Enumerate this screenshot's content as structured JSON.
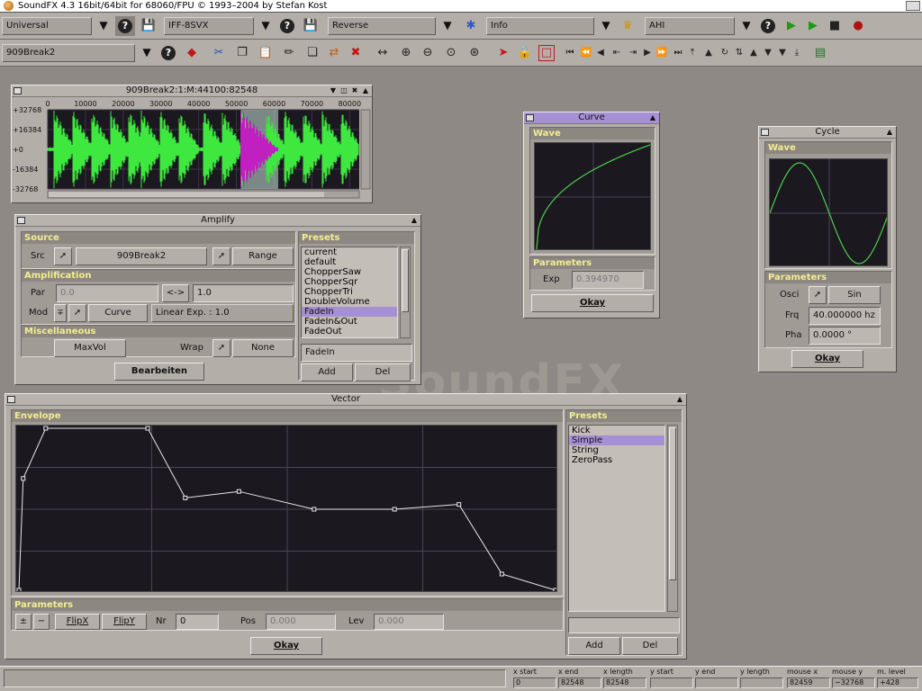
{
  "app": {
    "title": "SoundFX  4.3 16bit/64bit for 68060/FPU © 1993–2004 by Stefan Kost",
    "bg_logo": "SoundFX"
  },
  "toolbar": {
    "profile": "Universal",
    "loader": "IFF-8SVX",
    "operator": "Reverse",
    "info": "Info",
    "player": "AHI",
    "sample": "909Break2",
    "help": "?"
  },
  "sample_window": {
    "title": "909Break2:1:M:44100:82548",
    "x_ticks": [
      "0",
      "10000",
      "20000",
      "30000",
      "40000",
      "50000",
      "60000",
      "70000",
      "80000"
    ],
    "y_ticks": [
      "+32768",
      "+16384",
      "+0",
      "-16384",
      "-32768"
    ]
  },
  "amplify": {
    "title": "Amplify",
    "source_hdr": "Source",
    "src_label": "Src",
    "src_value": "909Break2",
    "range_label": "Range",
    "ampl_hdr": "Amplification",
    "par_label": "Par",
    "par_value1": "0.0",
    "swap_label": "<->",
    "par_value2": "1.0",
    "mod_label": "Mod",
    "curve_label": "Curve",
    "mod_desc": "Linear Exp. : 1.0",
    "misc_hdr": "Miscellaneous",
    "maxvol_label": "MaxVol",
    "wrap_label": "Wrap",
    "wrap_value": "None",
    "edit_label": "Bearbeiten",
    "presets_hdr": "Presets",
    "presets": [
      "current",
      "default",
      "ChopperSaw",
      "ChopperSqr",
      "ChopperTri",
      "DoubleVolume",
      "FadeIn",
      "FadeIn&Out",
      "FadeOut"
    ],
    "selected_preset": "FadeIn",
    "preset_name": "FadeIn",
    "add_label": "Add",
    "del_label": "Del"
  },
  "curve": {
    "title": "Curve",
    "wave_hdr": "Wave",
    "params_hdr": "Parameters",
    "exp_label": "Exp",
    "exp_value": "0.394970",
    "okay_label": "Okay",
    "curve_color": "#4ad04a"
  },
  "cycle": {
    "title": "Cycle",
    "wave_hdr": "Wave",
    "params_hdr": "Parameters",
    "osci_label": "Osci",
    "osci_value": "Sin",
    "frq_label": "Frq",
    "frq_value": "40.000000 hz",
    "pha_label": "Pha",
    "pha_value": "0.0000 °",
    "okay_label": "Okay"
  },
  "vector": {
    "title": "Vector",
    "env_hdr": "Envelope",
    "params_hdr": "Parameters",
    "pm_label": "±",
    "minus_label": "−",
    "flipx_label": "FlipX",
    "flipy_label": "FlipY",
    "nr_label": "Nr",
    "nr_value": "0",
    "pos_label": "Pos",
    "pos_value": "0.000",
    "lev_label": "Lev",
    "lev_value": "0.000",
    "okay_label": "Okay",
    "presets_hdr": "Presets",
    "presets": [
      "Kick",
      "Simple",
      "String",
      "ZeroPass"
    ],
    "selected_preset": "Simple",
    "add_label": "Add",
    "del_label": "Del",
    "envelope_points": [
      [
        0,
        0
      ],
      [
        0.008,
        0.69
      ],
      [
        0.05,
        1
      ],
      [
        0.24,
        1
      ],
      [
        0.31,
        0.57
      ],
      [
        0.41,
        0.61
      ],
      [
        0.55,
        0.5
      ],
      [
        0.7,
        0.5
      ],
      [
        0.82,
        0.53
      ],
      [
        0.9,
        0.1
      ],
      [
        1,
        0
      ]
    ]
  },
  "status": {
    "x_start_h": "x start",
    "x_start": "0",
    "x_end_h": "x end",
    "x_end": "82548",
    "x_length_h": "x length",
    "x_length": "82548",
    "y_start_h": "y start",
    "y_start": "",
    "y_end_h": "y end",
    "y_end": "",
    "y_length_h": "y length",
    "y_length": "",
    "mouse_x_h": "mouse x",
    "mouse_x": "82459",
    "mouse_y_h": "mouse y",
    "mouse_y": "−32768",
    "m_level_h": "m. level",
    "m_level": "+428"
  },
  "colors": {
    "accent": "#a490d4",
    "wave": "#3ee83e",
    "selection": "#c020c0",
    "header_text": "#f2ee90"
  }
}
